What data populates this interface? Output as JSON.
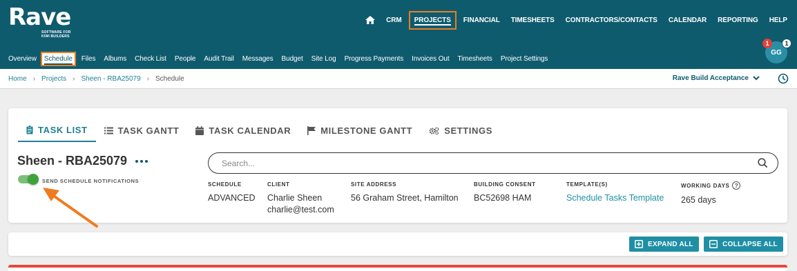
{
  "logo": {
    "word": "Rave",
    "tagline": "SOFTWARE FOR KIWI BUILDERS"
  },
  "main_nav": [
    {
      "label": "CRM"
    },
    {
      "label": "PROJECTS",
      "active": true
    },
    {
      "label": "FINANCIAL"
    },
    {
      "label": "TIMESHEETS"
    },
    {
      "label": "CONTRACTORS/CONTACTS"
    },
    {
      "label": "CALENDAR"
    },
    {
      "label": "REPORTING"
    },
    {
      "label": "HELP"
    }
  ],
  "sub_nav": [
    {
      "label": "Overview"
    },
    {
      "label": "Schedule",
      "active": true
    },
    {
      "label": "Files"
    },
    {
      "label": "Albums"
    },
    {
      "label": "Check List"
    },
    {
      "label": "People"
    },
    {
      "label": "Audit Trail"
    },
    {
      "label": "Messages"
    },
    {
      "label": "Budget"
    },
    {
      "label": "Site Log"
    },
    {
      "label": "Progress Payments"
    },
    {
      "label": "Invoices Out"
    },
    {
      "label": "Timesheets"
    },
    {
      "label": "Project Settings"
    }
  ],
  "user": {
    "initials": "GG",
    "notification_count": "1",
    "message_count": "1"
  },
  "breadcrumb": {
    "home": "Home",
    "projects": "Projects",
    "project": "Sheen - RBA25079",
    "current": "Schedule"
  },
  "company": "Rave Build Acceptance",
  "tabs": [
    {
      "label": "TASK LIST",
      "icon": "clipboard-icon",
      "active": true
    },
    {
      "label": "TASK GANTT",
      "icon": "list-icon"
    },
    {
      "label": "TASK CALENDAR",
      "icon": "calendar-icon"
    },
    {
      "label": "MILESTONE GANTT",
      "icon": "flag-icon"
    },
    {
      "label": "SETTINGS",
      "icon": "gears-icon"
    }
  ],
  "project": {
    "title": "Sheen - RBA25079"
  },
  "notifications": {
    "label": "SEND SCHEDULE NOTIFICATIONS",
    "enabled": true
  },
  "search": {
    "placeholder": "Search..."
  },
  "info": {
    "schedule": {
      "label": "SCHEDULE",
      "value": "ADVANCED"
    },
    "client": {
      "label": "CLIENT",
      "name": "Charlie Sheen",
      "email": "charlie@test.com"
    },
    "site_address": {
      "label": "SITE ADDRESS",
      "value": "56 Graham Street, Hamilton"
    },
    "building_consent": {
      "label": "BUILDING CONSENT",
      "value": "BC52698 HAM"
    },
    "templates": {
      "label": "TEMPLATE(S)",
      "value": "Schedule Tasks Template"
    },
    "working_days": {
      "label": "WORKING DAYS",
      "value": "265 days",
      "help": "?"
    }
  },
  "buttons": {
    "expand_all": "EXPAND ALL",
    "collapse_all": "COLLAPSE ALL"
  },
  "colors": {
    "header": "#0f5b6e",
    "accent": "#1f8fa5",
    "highlight": "#f07b1e",
    "toggle_on": "#3fa33c",
    "alert": "#e5483f"
  }
}
